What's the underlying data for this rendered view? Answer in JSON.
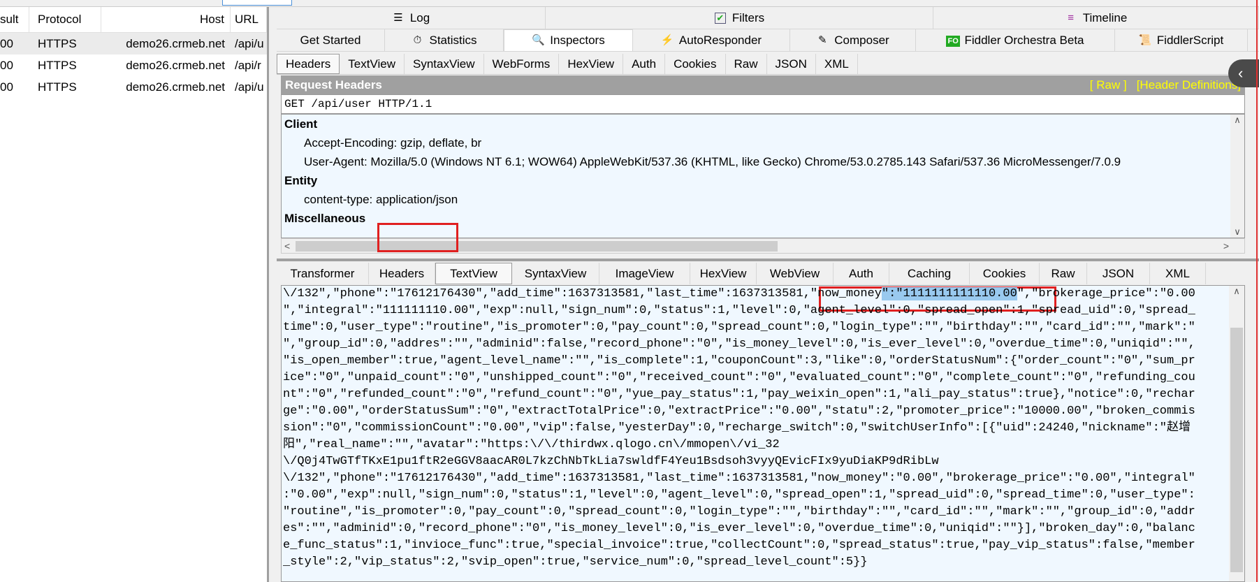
{
  "sessions": {
    "columns": [
      "sult",
      "Protocol",
      "Host",
      "URL"
    ],
    "rows": [
      {
        "result": "00",
        "protocol": "HTTPS",
        "host": "demo26.crmeb.net",
        "url": "/api/u"
      },
      {
        "result": "00",
        "protocol": "HTTPS",
        "host": "demo26.crmeb.net",
        "url": "/api/r"
      },
      {
        "result": "00",
        "protocol": "HTTPS",
        "host": "demo26.crmeb.net",
        "url": "/api/u"
      }
    ]
  },
  "top_tabs": [
    {
      "label": "Log",
      "icon": "log-icon"
    },
    {
      "label": "Filters",
      "icon": "checkbox-icon"
    },
    {
      "label": "Timeline",
      "icon": "timeline-icon"
    }
  ],
  "main_tabs": [
    {
      "label": "Get Started"
    },
    {
      "label": "Statistics"
    },
    {
      "label": "Inspectors"
    },
    {
      "label": "AutoResponder"
    },
    {
      "label": "Composer"
    },
    {
      "label": "Fiddler Orchestra Beta",
      "badge": "FO"
    },
    {
      "label": "FiddlerScript"
    }
  ],
  "request_tabs": [
    "Headers",
    "TextView",
    "SyntaxView",
    "WebForms",
    "HexView",
    "Auth",
    "Cookies",
    "Raw",
    "JSON",
    "XML"
  ],
  "request": {
    "title": "Request Headers",
    "raw_link": "[ Raw ]",
    "defs_link": "[Header Definitions]",
    "request_line": "GET /api/user HTTP/1.1",
    "groups": [
      {
        "name": "Client",
        "headers": [
          "Accept-Encoding: gzip, deflate, br",
          "User-Agent: Mozilla/5.0 (Windows NT 6.1; WOW64) AppleWebKit/537.36 (KHTML, like Gecko) Chrome/53.0.2785.143 Safari/537.36 MicroMessenger/7.0.9"
        ]
      },
      {
        "name": "Entity",
        "headers": [
          "content-type: application/json"
        ]
      },
      {
        "name": "Miscellaneous",
        "headers": []
      }
    ]
  },
  "response_tabs": [
    "Transformer",
    "Headers",
    "TextView",
    "SyntaxView",
    "ImageView",
    "HexView",
    "WebView",
    "Auth",
    "Caching",
    "Cookies",
    "Raw",
    "JSON",
    "XML"
  ],
  "response": {
    "line1_pre": "\\/132\",\"phone\":\"17612176430\",\"add_time\":1637313581,\"last_time\":1637313581,\"now_money",
    "line1_sel": "\":\"1111111111110.00",
    "line1_post": "\",\"brokerage_price\":\"0.00",
    "lines": [
      "\",\"integral\":\"111111110.00\",\"exp\":null,\"sign_num\":0,\"status\":1,\"level\":0,\"agent_level\":0,\"spread_open\":1,\"spread_uid\":0,\"spread_",
      "time\":0,\"user_type\":\"routine\",\"is_promoter\":0,\"pay_count\":0,\"spread_count\":0,\"login_type\":\"\",\"birthday\":\"\",\"card_id\":\"\",\"mark\":\"",
      "\",\"group_id\":0,\"addres\":\"\",\"adminid\":false,\"record_phone\":\"0\",\"is_money_level\":0,\"is_ever_level\":0,\"overdue_time\":0,\"uniqid\":\"\",",
      "\"is_open_member\":true,\"agent_level_name\":\"\",\"is_complete\":1,\"couponCount\":3,\"like\":0,\"orderStatusNum\":{\"order_count\":\"0\",\"sum_pr",
      "ice\":\"0\",\"unpaid_count\":\"0\",\"unshipped_count\":\"0\",\"received_count\":\"0\",\"evaluated_count\":\"0\",\"complete_count\":\"0\",\"refunding_cou",
      "nt\":\"0\",\"refunded_count\":\"0\",\"refund_count\":\"0\",\"yue_pay_status\":1,\"pay_weixin_open\":1,\"ali_pay_status\":true},\"notice\":0,\"rechar",
      "ge\":\"0.00\",\"orderStatusSum\":\"0\",\"extractTotalPrice\":0,\"extractPrice\":\"0.00\",\"statu\":2,\"promoter_price\":\"10000.00\",\"broken_commis",
      "sion\":\"0\",\"commissionCount\":\"0.00\",\"vip\":false,\"yesterDay\":0,\"recharge_switch\":0,\"switchUserInfo\":[{\"uid\":24240,\"nickname\":\"赵增",
      "阳\",\"real_name\":\"\",\"avatar\":\"https:\\/\\/thirdwx.qlogo.cn\\/mmopen\\/vi_32",
      "\\/Q0j4TwGTfTKxE1pu1ftR2eGGV8aacAR0L7kzChNbTkLia7swldfF4Yeu1Bsdsoh3vyyQEvicFIx9yuDiaKP9dRibLw",
      "\\/132\",\"phone\":\"17612176430\",\"add_time\":1637313581,\"last_time\":1637313581,\"now_money\":\"0.00\",\"brokerage_price\":\"0.00\",\"integral\"",
      ":\"0.00\",\"exp\":null,\"sign_num\":0,\"status\":1,\"level\":0,\"agent_level\":0,\"spread_open\":1,\"spread_uid\":0,\"spread_time\":0,\"user_type\":",
      "\"routine\",\"is_promoter\":0,\"pay_count\":0,\"spread_count\":0,\"login_type\":\"\",\"birthday\":\"\",\"card_id\":\"\",\"mark\":\"\",\"group_id\":0,\"addr",
      "es\":\"\",\"adminid\":0,\"record_phone\":\"0\",\"is_money_level\":0,\"is_ever_level\":0,\"overdue_time\":0,\"uniqid\":\"\"}],\"broken_day\":0,\"balanc",
      "e_func_status\":1,\"invioce_func\":true,\"special_invoice\":true,\"collectCount\":0,\"spread_status\":true,\"pay_vip_status\":false,\"member",
      "_style\":2,\"vip_status\":2,\"svip_open\":true,\"service_num\":0,\"spread_level_count\":5}}"
    ]
  }
}
